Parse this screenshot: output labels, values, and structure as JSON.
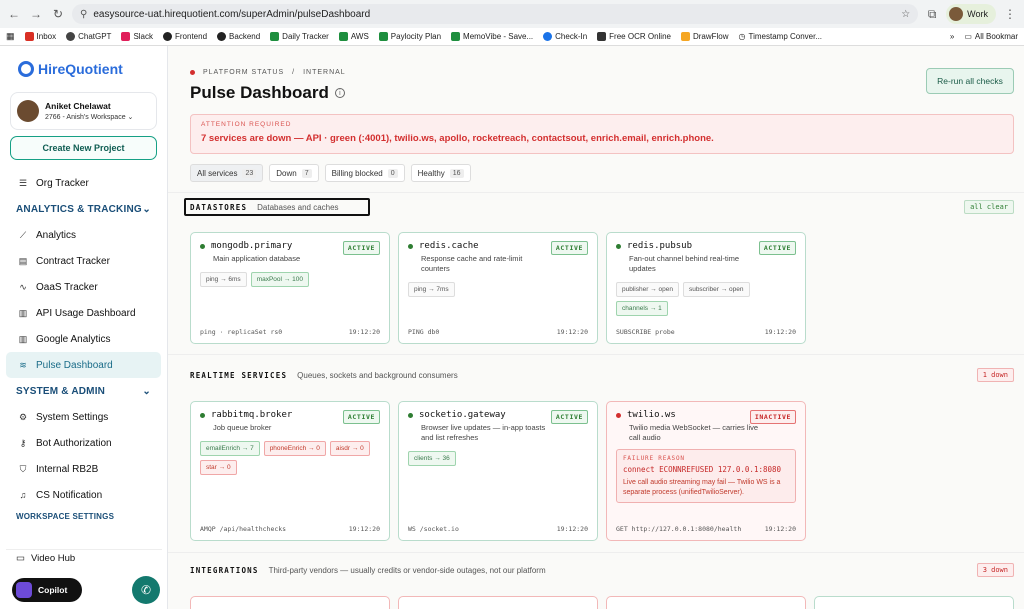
{
  "browser": {
    "url": "easysource-uat.hirequotient.com/superAdmin/pulseDashboard",
    "profile": "Work",
    "bookmarks": [
      "Inbox",
      "ChatGPT",
      "Slack",
      "Frontend",
      "Backend",
      "Daily Tracker",
      "AWS",
      "Paylocity Plan",
      "MemoVibe - Save...",
      "Check-In",
      "Free OCR Online",
      "DrawFlow",
      "Timestamp Conver..."
    ],
    "bookmarks_more": "»",
    "all_bookmarks": "All Bookmar"
  },
  "sidebar": {
    "logo": "HireQuotient",
    "user": {
      "name": "Aniket Chelawat",
      "workspace": "2766 - Anish's Workspace"
    },
    "create_button": "Create New Project",
    "org_tracker": "Org Tracker",
    "section_analytics": "ANALYTICS & TRACKING",
    "analytics_items": [
      "Analytics",
      "Contract Tracker",
      "OaaS Tracker",
      "API Usage Dashboard",
      "Google Analytics",
      "Pulse Dashboard"
    ],
    "section_system": "SYSTEM & ADMIN",
    "system_items": [
      "System Settings",
      "Bot Authorization",
      "Internal RB2B",
      "CS Notification"
    ],
    "section_workspace": "WORKSPACE SETTINGS",
    "video_hub": "Video Hub",
    "copilot": "Copilot"
  },
  "header": {
    "status_label": "PLATFORM STATUS",
    "status_sep": "/",
    "status_env": "INTERNAL",
    "title": "Pulse Dashboard",
    "rerun_button": "Re-run all checks"
  },
  "alert": {
    "heading": "ATTENTION REQUIRED",
    "message": "7 services are down — API · green (:4001), twilio.ws, apollo, rocketreach, contactsout, enrich.email, enrich.phone."
  },
  "filters": [
    {
      "label": "All services",
      "count": "23"
    },
    {
      "label": "Down",
      "count": "7"
    },
    {
      "label": "Billing blocked",
      "count": "0"
    },
    {
      "label": "Healthy",
      "count": "16"
    }
  ],
  "sections": {
    "datastores": {
      "title": "DATASTORES",
      "desc": "Databases and caches",
      "badge": "all clear"
    },
    "realtime": {
      "title": "REALTIME SERVICES",
      "desc": "Queues, sockets and background consumers",
      "badge": "1 down"
    },
    "integrations": {
      "title": "INTEGRATIONS",
      "desc": "Third-party vendors — usually credits or vendor-side outages, not our platform",
      "badge": "3 down"
    }
  },
  "cards": {
    "mongodb": {
      "name": "mongodb.primary",
      "desc": "Main application database",
      "status": "ACTIVE",
      "m1": "ping → 6ms",
      "m2": "maxPool → 100",
      "probe": "ping · replicaSet rs0",
      "time": "19:12:20"
    },
    "rediscache": {
      "name": "redis.cache",
      "desc": "Response cache and rate-limit counters",
      "status": "ACTIVE",
      "m1": "ping → 7ms",
      "probe": "PING db0",
      "time": "19:12:20"
    },
    "redispubsub": {
      "name": "redis.pubsub",
      "desc": "Fan-out channel behind real-time updates",
      "status": "ACTIVE",
      "m1": "publisher → open",
      "m2": "subscriber → open",
      "m3": "channels → 1",
      "probe": "SUBSCRIBE probe",
      "time": "19:12:20"
    },
    "rabbitmq": {
      "name": "rabbitmq.broker",
      "desc": "Job queue broker",
      "status": "ACTIVE",
      "m1": "emailEnrich → 7",
      "m2": "phoneEnrich → 0",
      "m3": "aisdr → 0",
      "m4": "star → 0",
      "probe": "AMQP /api/healthchecks",
      "time": "19:12:20"
    },
    "socketio": {
      "name": "socketio.gateway",
      "desc": "Browser live updates — in-app toasts and list refreshes",
      "status": "ACTIVE",
      "m1": "clients → 36",
      "probe": "WS /socket.io",
      "time": "19:12:20"
    },
    "twilio": {
      "name": "twilio.ws",
      "desc": "Twilio media WebSocket — carries live call audio",
      "status": "INACTIVE",
      "fail_label": "FAILURE REASON",
      "fail_code": "connect ECONNREFUSED 127.0.0.1:8080",
      "fail_text": "Live call audio streaming may fail — Twilio WS is a separate process (unifiedTwilioServer).",
      "probe": "GET http://127.0.0.1:8080/health",
      "time": "19:12:20"
    }
  }
}
